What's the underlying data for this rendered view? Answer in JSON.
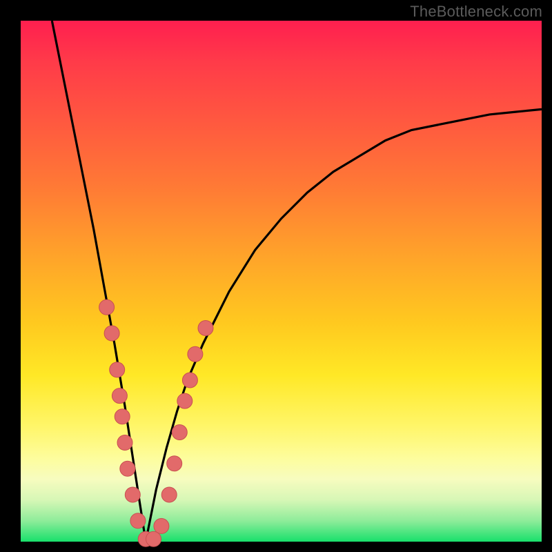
{
  "watermark": "TheBottleneck.com",
  "colors": {
    "frame": "#000000",
    "curve": "#000000",
    "marker_fill": "#e26a6a",
    "marker_stroke": "#c85050",
    "gradient_top": "#ff1f4f",
    "gradient_bottom": "#18e06b"
  },
  "chart_data": {
    "type": "line",
    "title": "",
    "xlabel": "",
    "ylabel": "",
    "xlim": [
      0,
      100
    ],
    "ylim": [
      0,
      100
    ],
    "note": "Axes are unlabeled; values estimated from pixel positions. y=0 is the green floor (good), y=100 is red top (bad). The black curve is a V-shaped bottleneck curve with minimum near x≈24. Salmon markers cluster around the trough.",
    "series": [
      {
        "name": "bottleneck-curve",
        "x": [
          6,
          8,
          10,
          12,
          14,
          16,
          18,
          20,
          22,
          24,
          26,
          28,
          30,
          32,
          35,
          40,
          45,
          50,
          55,
          60,
          65,
          70,
          75,
          80,
          85,
          90,
          95,
          100
        ],
        "y": [
          100,
          90,
          80,
          70,
          60,
          49,
          38,
          26,
          13,
          0,
          10,
          18,
          25,
          31,
          38,
          48,
          56,
          62,
          67,
          71,
          74,
          77,
          79,
          80,
          81,
          82,
          82.5,
          83
        ]
      }
    ],
    "markers": [
      {
        "x": 16.5,
        "y": 45
      },
      {
        "x": 17.5,
        "y": 40
      },
      {
        "x": 18.5,
        "y": 33
      },
      {
        "x": 19.0,
        "y": 28
      },
      {
        "x": 19.5,
        "y": 24
      },
      {
        "x": 20.0,
        "y": 19
      },
      {
        "x": 20.5,
        "y": 14
      },
      {
        "x": 21.5,
        "y": 9
      },
      {
        "x": 22.5,
        "y": 4
      },
      {
        "x": 24.0,
        "y": 0.5
      },
      {
        "x": 25.5,
        "y": 0.5
      },
      {
        "x": 27.0,
        "y": 3
      },
      {
        "x": 28.5,
        "y": 9
      },
      {
        "x": 29.5,
        "y": 15
      },
      {
        "x": 30.5,
        "y": 21
      },
      {
        "x": 31.5,
        "y": 27
      },
      {
        "x": 32.5,
        "y": 31
      },
      {
        "x": 33.5,
        "y": 36
      },
      {
        "x": 35.5,
        "y": 41
      }
    ]
  }
}
